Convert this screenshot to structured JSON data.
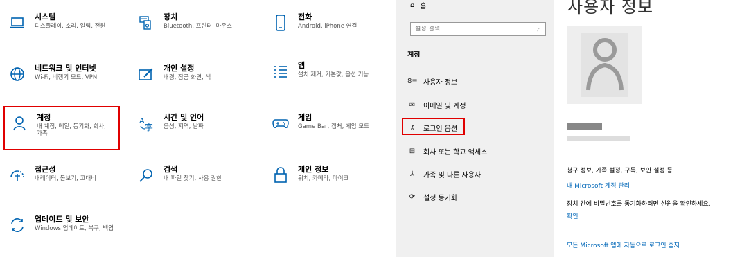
{
  "categories": [
    {
      "title": "시스템",
      "desc": "디스플레이, 소리, 알림, 전원",
      "icon": "laptop-icon"
    },
    {
      "title": "장치",
      "desc": "Bluetooth, 프린터, 마우스",
      "icon": "devices-icon"
    },
    {
      "title": "전화",
      "desc": "Android, iPhone 연결",
      "icon": "phone-icon"
    },
    {
      "title": "네트워크 및 인터넷",
      "desc": "Wi-Fi, 비행기 모드, VPN",
      "icon": "globe-icon"
    },
    {
      "title": "개인 설정",
      "desc": "배경, 잠금 화면, 색",
      "icon": "paint-icon"
    },
    {
      "title": "앱",
      "desc": "설치 제거, 기본값, 옵션 기능",
      "icon": "apps-list-icon"
    },
    {
      "title": "계정",
      "desc": "내 계정, 메일, 동기화, 회사, 가족",
      "icon": "person-icon"
    },
    {
      "title": "시간 및 언어",
      "desc": "음성, 지역, 날짜",
      "icon": "time-language-icon"
    },
    {
      "title": "게임",
      "desc": "Game Bar, 캡처, 게임 모드",
      "icon": "gamepad-icon"
    },
    {
      "title": "접근성",
      "desc": "내레이터, 돋보기, 고대비",
      "icon": "accessibility-icon"
    },
    {
      "title": "검색",
      "desc": "내 파일 찾기, 사용 권한",
      "icon": "search-icon"
    },
    {
      "title": "개인 정보",
      "desc": "위치, 카메라, 마이크",
      "icon": "lock-icon"
    },
    {
      "title": "업데이트 및 보안",
      "desc": "Windows 업데이트, 복구, 백업",
      "icon": "update-icon"
    }
  ],
  "nav": {
    "home": "홈",
    "search_placeholder": "설정 검색",
    "section": "계정",
    "items": [
      {
        "label": "사용자 정보",
        "icon": "user-info-icon"
      },
      {
        "label": "이메일 및 계정",
        "icon": "mail-icon"
      },
      {
        "label": "로그인 옵션",
        "icon": "key-icon"
      },
      {
        "label": "회사 또는 학교 액세스",
        "icon": "briefcase-icon"
      },
      {
        "label": "가족 및 다른 사용자",
        "icon": "family-icon"
      },
      {
        "label": "설정 동기화",
        "icon": "sync-icon"
      }
    ]
  },
  "right": {
    "title": "사용자 정보",
    "billing_text": "청구 정보, 가족 설정, 구독, 보안 설정 등",
    "manage_link": "내 Microsoft 계정 관리",
    "verify_text": "장치 간에 비밀번호를 동기화하려면 신원을 확인하세요.",
    "verify_link": "확인",
    "stop_link": "모든 Microsoft 앱에 자동으로 로그인 중지"
  }
}
